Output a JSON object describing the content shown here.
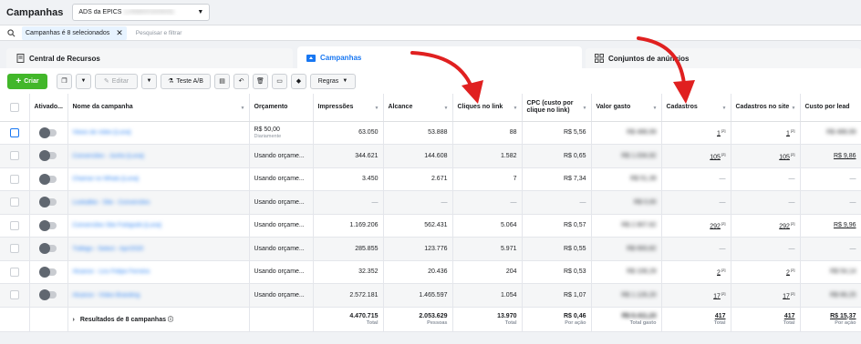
{
  "header": {
    "title": "Campanhas",
    "account_name": "ADS da EPICS",
    "account_id": "(1498800340849)"
  },
  "filter": {
    "chip": "Campanhas é 8 selecionados",
    "placeholder": "Pesquisar e filtrar"
  },
  "tabs": [
    {
      "label": "Central de Recursos"
    },
    {
      "label": "Campanhas"
    },
    {
      "label": "Conjuntos de anúncios"
    }
  ],
  "toolbar": {
    "create": "Criar",
    "edit": "Editar",
    "ab_test": "Teste A/B",
    "rules": "Regras"
  },
  "table": {
    "columns": [
      "Ativado...",
      "Nome da campanha",
      "Orçamento",
      "Impressões",
      "Alcance",
      "Cliques no link",
      "CPC (custo por clique no link)",
      "Valor gasto",
      "Cadastros",
      "Cadastros no site",
      "Custo por lead"
    ],
    "rows": [
      {
        "name": "Views de vídeo [Luna]",
        "budget": "R$ 50,00",
        "budget_sub": "Diariamente",
        "impressions": "63.050",
        "reach": "53.888",
        "clicks": "88",
        "cpc": "R$ 5,56",
        "spent": "R$ 488,99",
        "leads": "1",
        "site_leads": "1",
        "cpl": "R$ 488,99"
      },
      {
        "name": "Conversões - Junho [Luna]",
        "budget": "Usando orçame...",
        "budget_sub": "",
        "impressions": "344.621",
        "reach": "144.608",
        "clicks": "1.582",
        "cpc": "R$ 0,65",
        "spent": "R$ 1.034,92",
        "leads": "105",
        "site_leads": "105",
        "cpl": "R$ 9,86"
      },
      {
        "name": "Chamar no Whats [Luna]",
        "budget": "Usando orçame...",
        "budget_sub": "",
        "impressions": "3.450",
        "reach": "2.671",
        "clicks": "7",
        "cpc": "R$ 7,34",
        "spent": "R$ 51,39",
        "leads": "—",
        "site_leads": "—",
        "cpl": "—"
      },
      {
        "name": "Lookalike - Site - Conversões",
        "budget": "Usando orçame...",
        "budget_sub": "",
        "impressions": "—",
        "reach": "—",
        "clicks": "—",
        "cpc": "—",
        "spent": "R$ 0,00",
        "leads": "—",
        "site_leads": "—",
        "cpl": "—"
      },
      {
        "name": "Conversões Site Fotógrafo [Luna]",
        "budget": "Usando orçame...",
        "budget_sub": "",
        "impressions": "1.169.206",
        "reach": "562.431",
        "clicks": "5.064",
        "cpc": "R$ 0,57",
        "spent": "R$ 2.907,62",
        "leads": "292",
        "site_leads": "292",
        "cpl": "R$ 9,96"
      },
      {
        "name": "Tráfego - Select - Apr/2020",
        "budget": "Usando orçame...",
        "budget_sub": "",
        "impressions": "285.855",
        "reach": "123.776",
        "clicks": "5.971",
        "cpc": "R$ 0,55",
        "spent": "R$ 693,82",
        "leads": "—",
        "site_leads": "—",
        "cpl": "—"
      },
      {
        "name": "Alcance - Lics Felipe Ferreira",
        "budget": "Usando orçame...",
        "budget_sub": "",
        "impressions": "32.352",
        "reach": "20.436",
        "clicks": "204",
        "cpc": "R$ 0,53",
        "spent": "R$ 108,29",
        "leads": "2",
        "site_leads": "2",
        "cpl": "R$ 54,14"
      },
      {
        "name": "Alcance - Vídeo Branding",
        "budget": "Usando orçame...",
        "budget_sub": "",
        "impressions": "2.572.181",
        "reach": "1.465.597",
        "clicks": "1.054",
        "cpc": "R$ 1,07",
        "spent": "R$ 1.126,20",
        "leads": "17",
        "site_leads": "17",
        "cpl": "R$ 66,25"
      }
    ],
    "totals": {
      "label": "Resultados de 8 campanhas",
      "impressions": "4.470.715",
      "impressions_sub": "Total",
      "reach": "2.053.629",
      "reach_sub": "Pessoas",
      "clicks": "13.970",
      "clicks_sub": "Total",
      "cpc": "R$ 0,46",
      "cpc_sub": "Por ação",
      "spent": "R$ 6.411,23",
      "spent_sub": "Total gasto",
      "leads": "417",
      "leads_sub": "Total",
      "site_leads": "417",
      "site_leads_sub": "Total",
      "cpl": "R$ 15,37",
      "cpl_sub": "Por ação"
    }
  },
  "colors": {
    "accent": "#1877f2",
    "create_button": "#42b72a",
    "annotation_arrow": "#e02020"
  }
}
